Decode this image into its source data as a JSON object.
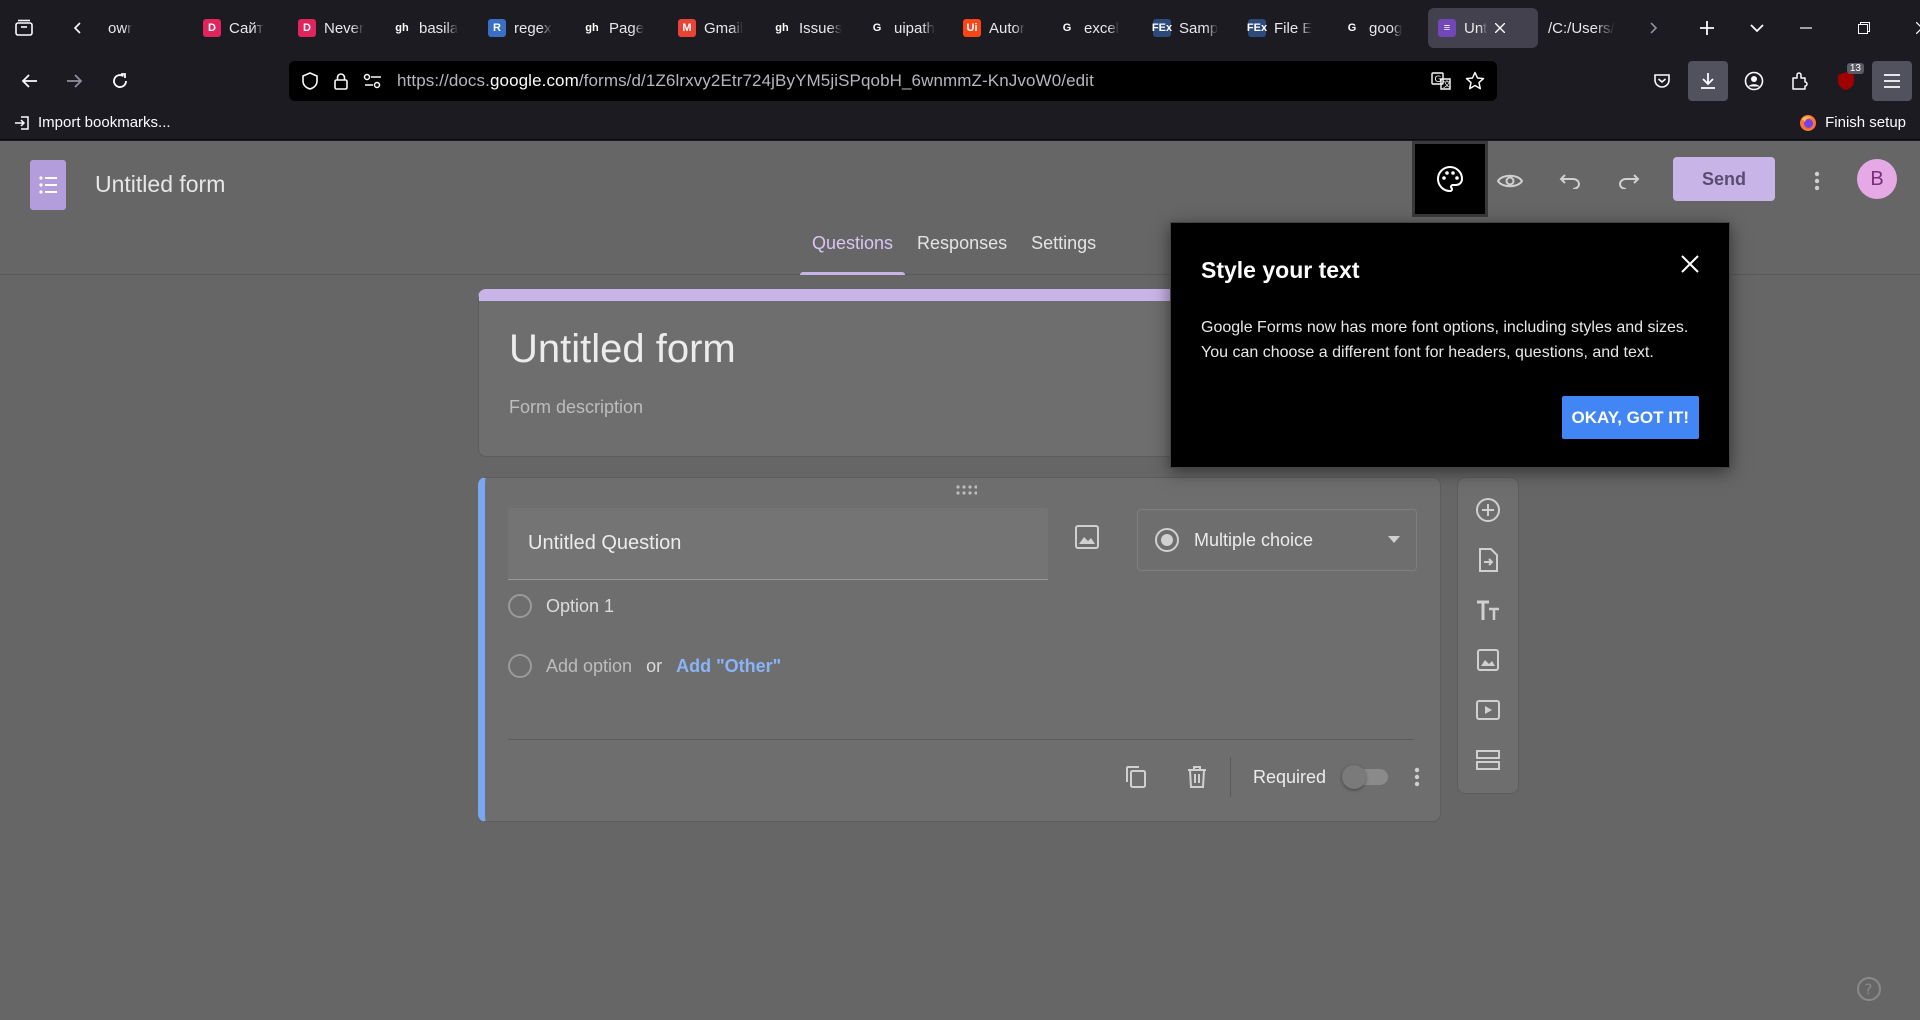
{
  "browser": {
    "tabs": [
      {
        "label": "owr",
        "favicon": "",
        "color": "#42414d"
      },
      {
        "label": "Сайт",
        "favicon": "D",
        "color": "#e0245e"
      },
      {
        "label": "Never",
        "favicon": "D",
        "color": "#e0245e"
      },
      {
        "label": "basila",
        "favicon": "gh",
        "color": "#ffffff"
      },
      {
        "label": "regex",
        "favicon": "R",
        "color": "#3a6fc4"
      },
      {
        "label": "Page",
        "favicon": "gh",
        "color": "#ffffff"
      },
      {
        "label": "Gmail",
        "favicon": "M",
        "color": "#ea4335"
      },
      {
        "label": "Issues",
        "favicon": "gh",
        "color": "#ffffff"
      },
      {
        "label": "uipath",
        "favicon": "G",
        "color": "#ffffff"
      },
      {
        "label": "Autor",
        "favicon": "Ui",
        "color": "#fa4616"
      },
      {
        "label": "excel",
        "favicon": "G",
        "color": "#ffffff"
      },
      {
        "label": "Samp",
        "favicon": "FEx",
        "color": "#2d4a7a"
      },
      {
        "label": "File E",
        "favicon": "FEx",
        "color": "#2d4a7a"
      },
      {
        "label": "goog",
        "favicon": "G",
        "color": "#ffffff"
      },
      {
        "label": "Unt",
        "favicon": "≡",
        "color": "#7248b9"
      },
      {
        "label": "/C:/Users/",
        "favicon": "",
        "color": "#42414d"
      }
    ],
    "url_prefix": "https://docs.",
    "url_domain": "google.com",
    "url_path": "/forms/d/1Z6lrxvy2Etr724jByYM5jiSPqobH_6wnmmZ-KnJvoW0/edit",
    "import_bookmarks": "Import bookmarks...",
    "finish_setup": "Finish setup",
    "extension_badge": "13"
  },
  "forms": {
    "doc_title": "Untitled form",
    "send_label": "Send",
    "avatar_letter": "B",
    "tabs": [
      {
        "label": "Questions",
        "active": true
      },
      {
        "label": "Responses",
        "active": false
      },
      {
        "label": "Settings",
        "active": false
      }
    ],
    "form_title": "Untitled form",
    "form_description": "Form description",
    "question": {
      "title": "Untitled Question",
      "type": "Multiple choice",
      "option_1": "Option 1",
      "add_option": "Add option",
      "or": "or",
      "add_other": "Add \"Other\"",
      "required_label": "Required",
      "required": false
    }
  },
  "popup": {
    "title": "Style your text",
    "body": "Google Forms now has more font options, including styles and sizes. You can choose a different font for headers, questions, and text.",
    "ok_label": "OKAY, GOT IT!"
  },
  "colors": {
    "accent": "#c9b4e8",
    "question_border": "#7aa7f0",
    "ok_button": "#4285f4",
    "link": "#8ab4f8"
  }
}
